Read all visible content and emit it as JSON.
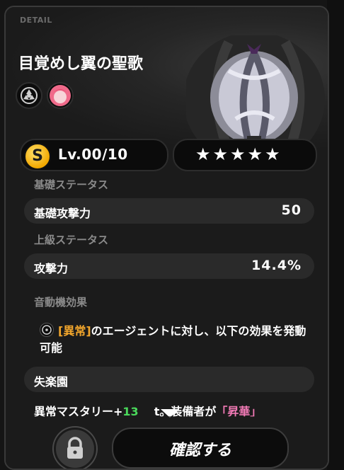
{
  "header": {
    "tag": "DETAIL",
    "title": "目覚めし翼の聖歌"
  },
  "level": {
    "rank": "S",
    "label": "Lv.00/10"
  },
  "stars": "★★★★★",
  "base_status": {
    "section_label": "基礎ステータス",
    "name": "基礎攻撃力",
    "value": "50"
  },
  "advanced_status": {
    "section_label": "上級ステータス",
    "name": "攻撃力",
    "value": "14.4%"
  },
  "effect": {
    "section_label": "音動機効果",
    "tag": "[異常]",
    "text": "のエージェントに対し、以下の効果を発動可能"
  },
  "set": {
    "name": "失楽園"
  },
  "bonus": {
    "prefix": "異常マスタリー+",
    "number": "13",
    "suffix": "t。装備者が",
    "highlight": "「昇華」"
  },
  "buttons": {
    "confirm": "確認する"
  },
  "icons": [
    "disc-icon",
    "agent-avatar-icon",
    "rank-s-icon",
    "star-icon",
    "lock-icon",
    "down-arrow-icon"
  ]
}
